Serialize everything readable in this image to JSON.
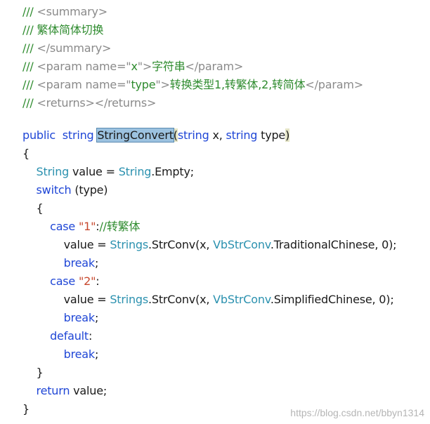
{
  "colors": {
    "comment": "#2e8b2e",
    "xml_tag": "#8a8a8a",
    "keyword": "#1f46d6",
    "type": "#2b91af",
    "string": "#c8492f",
    "selection": "#9cc2e0"
  },
  "code": {
    "lines": [
      [
        [
          "comment",
          "/// "
        ],
        [
          "xml",
          "<summary>"
        ]
      ],
      [
        [
          "comment",
          "/// 繁体简体切换"
        ]
      ],
      [
        [
          "comment",
          "/// "
        ],
        [
          "xml",
          "</summary>"
        ]
      ],
      [
        [
          "comment",
          "/// "
        ],
        [
          "xml",
          "<param name=\""
        ],
        [
          "comment",
          "x"
        ],
        [
          "xml",
          "\">"
        ],
        [
          "comment",
          "字符串"
        ],
        [
          "xml",
          "</param>"
        ]
      ],
      [
        [
          "comment",
          "/// "
        ],
        [
          "xml",
          "<param name=\""
        ],
        [
          "comment",
          "type"
        ],
        [
          "xml",
          "\">"
        ],
        [
          "comment",
          "转换类型1,转繁体,2,转简体"
        ],
        [
          "xml",
          "</param>"
        ]
      ],
      [
        [
          "comment",
          "/// "
        ],
        [
          "xml",
          "<returns></returns>"
        ]
      ],
      [],
      [
        [
          "keyword",
          "public"
        ],
        [
          "plain",
          "  "
        ],
        [
          "keyword",
          "string"
        ],
        [
          "plain",
          " "
        ],
        [
          "hl",
          "StringConvert"
        ],
        [
          "brace",
          "("
        ],
        [
          "keyword",
          "string"
        ],
        [
          "plain",
          " x, "
        ],
        [
          "keyword",
          "string"
        ],
        [
          "plain",
          " type"
        ],
        [
          "brace",
          ")"
        ]
      ],
      [
        [
          "plain",
          "{"
        ]
      ],
      [
        [
          "plain",
          "    "
        ],
        [
          "type",
          "String"
        ],
        [
          "plain",
          " value = "
        ],
        [
          "type",
          "String"
        ],
        [
          "plain",
          ".Empty;"
        ]
      ],
      [
        [
          "plain",
          "    "
        ],
        [
          "keyword",
          "switch"
        ],
        [
          "plain",
          " (type)"
        ]
      ],
      [
        [
          "plain",
          "    {"
        ]
      ],
      [
        [
          "plain",
          "        "
        ],
        [
          "keyword",
          "case"
        ],
        [
          "plain",
          " "
        ],
        [
          "string",
          "\"1\""
        ],
        [
          "plain",
          ":"
        ],
        [
          "comment",
          "//转繁体"
        ]
      ],
      [
        [
          "plain",
          "            value = "
        ],
        [
          "type",
          "Strings"
        ],
        [
          "plain",
          ".StrConv(x, "
        ],
        [
          "type",
          "VbStrConv"
        ],
        [
          "plain",
          ".TraditionalChinese, 0);"
        ]
      ],
      [
        [
          "plain",
          "            "
        ],
        [
          "keyword",
          "break"
        ],
        [
          "plain",
          ";"
        ]
      ],
      [
        [
          "plain",
          "        "
        ],
        [
          "keyword",
          "case"
        ],
        [
          "plain",
          " "
        ],
        [
          "string",
          "\"2\""
        ],
        [
          "plain",
          ":"
        ]
      ],
      [
        [
          "plain",
          "            value = "
        ],
        [
          "type",
          "Strings"
        ],
        [
          "plain",
          ".StrConv(x, "
        ],
        [
          "type",
          "VbStrConv"
        ],
        [
          "plain",
          ".SimplifiedChinese, 0);"
        ]
      ],
      [
        [
          "plain",
          "            "
        ],
        [
          "keyword",
          "break"
        ],
        [
          "plain",
          ";"
        ]
      ],
      [
        [
          "plain",
          "        "
        ],
        [
          "keyword",
          "default"
        ],
        [
          "plain",
          ":"
        ]
      ],
      [
        [
          "plain",
          "            "
        ],
        [
          "keyword",
          "break"
        ],
        [
          "plain",
          ";"
        ]
      ],
      [
        [
          "plain",
          "    }"
        ]
      ],
      [
        [
          "plain",
          "    "
        ],
        [
          "keyword",
          "return"
        ],
        [
          "plain",
          " value;"
        ]
      ],
      [
        [
          "plain",
          "}"
        ]
      ]
    ]
  },
  "watermark": "https://blog.csdn.net/bbyn1314"
}
